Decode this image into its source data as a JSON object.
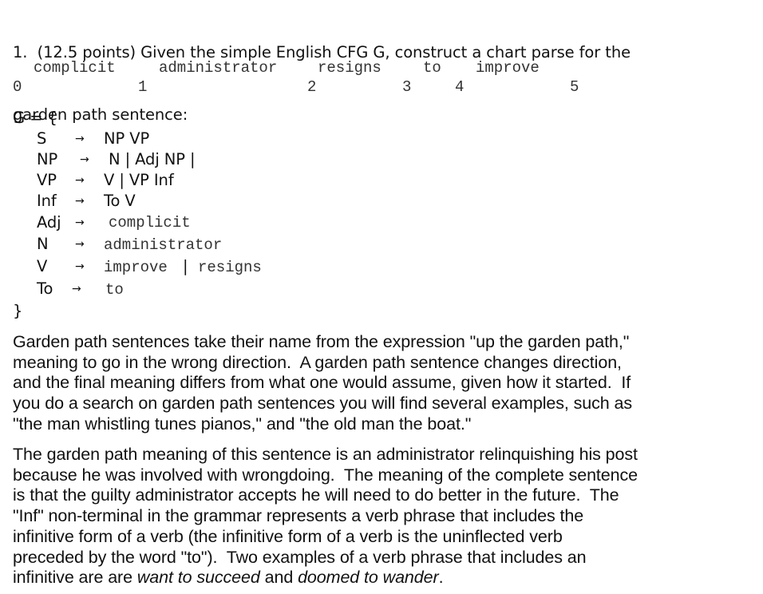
{
  "question": {
    "lines": [
      "1.  (12.5 points) Given the simple English CFG G, construct a chart parse for the",
      "garden path sentence:"
    ]
  },
  "sentence": {
    "words": [
      "complicit",
      "administrator",
      "resigns",
      "to",
      "improve"
    ],
    "positions": [
      "0",
      "1",
      "2",
      "3",
      "4",
      "5"
    ]
  },
  "grammar": {
    "open": "G = {",
    "close": "}",
    "arrow": "→",
    "rules": [
      {
        "lhs": "S",
        "rhs": "NP VP",
        "terminal": false
      },
      {
        "lhs": "NP",
        "rhs": "N | Adj NP |",
        "terminal": false
      },
      {
        "lhs": "VP",
        "rhs": "V | VP Inf",
        "terminal": false
      },
      {
        "lhs": "Inf",
        "rhs": "To V",
        "terminal": false
      },
      {
        "lhs": "Adj",
        "rhs": "complicit",
        "terminal": true
      },
      {
        "lhs": "N",
        "rhs": "administrator",
        "terminal": true
      },
      {
        "lhs": "V",
        "rhs_parts": [
          "improve",
          "|",
          "resigns"
        ],
        "terminal": true
      },
      {
        "lhs": "To",
        "rhs": "to",
        "terminal": true
      }
    ]
  },
  "paragraph1": {
    "lines": [
      "Garden path sentences take their name from the expression \"up the garden path,\"",
      "meaning to go in the wrong direction.  A garden path sentence changes direction,",
      "and the final meaning differs from what one would assume, given how it started.  If",
      "you do a search on garden path sentences you will find several examples, such as",
      "\"the man whistling tunes pianos,\" and \"the old man the boat.\""
    ]
  },
  "paragraph2": {
    "lines": [
      "The garden path meaning of this sentence is an administrator relinquishing his post",
      "because he was involved with wrongdoing.  The meaning of the complete sentence",
      "is that the guilty administrator accepts he will need to do better in the future.  The",
      "\"Inf\" non-terminal in the grammar represents a verb phrase that includes the",
      "infinitive form of a verb (the infinitive form of a verb is the uninflected verb",
      "preceded by the word \"to\").  Two examples of a verb phrase that includes an"
    ],
    "last_line": {
      "before": "infinitive are are ",
      "example1": "want to succeed",
      "middle": " and ",
      "example2": "doomed to wander",
      "after": "."
    }
  }
}
